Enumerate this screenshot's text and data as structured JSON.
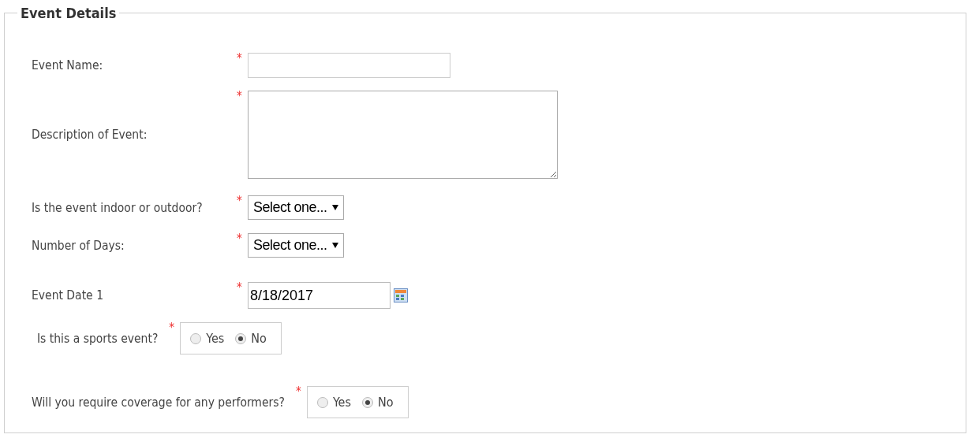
{
  "section": {
    "title": "Event Details"
  },
  "fields": [
    {
      "kind": "text",
      "label": "Event Name:",
      "required_mark": "*"
    },
    {
      "kind": "textarea",
      "label": "Description of Event:",
      "required_mark": "*"
    },
    {
      "kind": "select",
      "label": "Is the event indoor or outdoor?",
      "required_mark": "*",
      "value": "Select one..."
    },
    {
      "kind": "select",
      "label": "Number of Days:",
      "required_mark": "*",
      "value": "Select one..."
    },
    {
      "kind": "date",
      "label": "Event Date 1",
      "required_mark": "*",
      "value": "8/18/2017"
    },
    {
      "kind": "radio",
      "label": "Is this a sports event?",
      "required_mark": "*",
      "options": [
        {
          "label": "Yes",
          "selected": false
        },
        {
          "label": "No",
          "selected": true
        }
      ]
    },
    {
      "kind": "radio",
      "label": "Will you require coverage for any performers?",
      "required_mark": "*",
      "options": [
        {
          "label": "Yes",
          "selected": false
        },
        {
          "label": "No",
          "selected": true
        }
      ]
    }
  ]
}
